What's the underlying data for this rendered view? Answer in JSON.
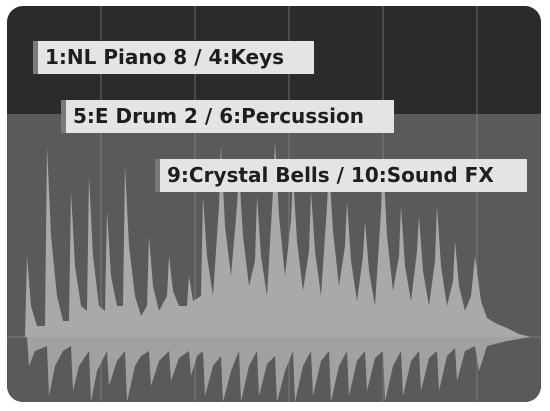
{
  "waveform_view": {
    "scenes": [
      {
        "label": "1:NL Piano 8 / 4:Keys"
      },
      {
        "label": "5:E Drum 2 / 6:Percussion"
      },
      {
        "label": "9:Crystal Bells / 10:Sound FX"
      }
    ]
  },
  "colors": {
    "background": "#2b2b2b",
    "selected_region": "#5a5a5a",
    "waveform": "#a9a9a9",
    "label_background": "#e4e4e4",
    "label_text": "#1e1e1e",
    "label_marker": "#7a7a7a"
  }
}
